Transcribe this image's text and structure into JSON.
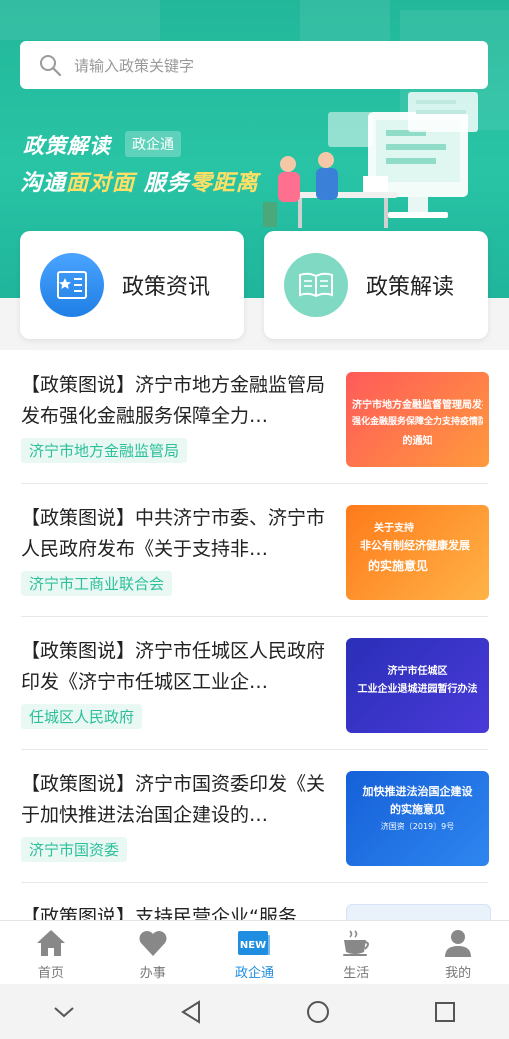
{
  "search": {
    "placeholder": "请输入政策关键字"
  },
  "banner": {
    "title": "政策解读",
    "tag": "政企通",
    "slogan_a": "沟通",
    "slogan_b": "面对面",
    "slogan_c": " 服务",
    "slogan_d": "零距离"
  },
  "cards": [
    {
      "label": "政策资讯",
      "icon": "news-book-icon",
      "color": "#2f8ff0"
    },
    {
      "label": "政策解读",
      "icon": "open-book-icon",
      "color": "#34c3a0"
    }
  ],
  "articles": [
    {
      "title": "【政策图说】济宁市地方金融监管局发布强化金融服务保障全力…",
      "tag": "济宁市地方金融监管局",
      "thumb_lines": [
        "济宁市地方金融监督管理局发布",
        "强化金融服务保障全力支持疫情防控工作",
        "的通知"
      ]
    },
    {
      "title": "【政策图说】中共济宁市委、济宁市人民政府发布《关于支持非…",
      "tag": "济宁市工商业联合会",
      "thumb_lines": [
        "关于支持",
        "非公有制经济健康发展",
        "的实施意见"
      ]
    },
    {
      "title": "【政策图说】济宁市任城区人民政府印发《济宁市任城区工业企…",
      "tag": "任城区人民政府",
      "thumb_lines": [
        "济宁市任城区",
        "工业企业退城进园暂行办法"
      ]
    },
    {
      "title": "【政策图说】济宁市国资委印发《关于加快推进法治国企建设的…",
      "tag": "济宁市国资委",
      "thumb_lines": [
        "加快推进法治国企建设",
        "的实施意见",
        "济国资〔2019〕9号"
      ]
    },
    {
      "title": "【政策图说】支持民营企业“服务…",
      "tag": "",
      "thumb_lines": []
    }
  ],
  "tabs": [
    {
      "label": "首页",
      "icon": "home-icon",
      "active": false
    },
    {
      "label": "办事",
      "icon": "heart-icon",
      "active": false
    },
    {
      "label": "政企通",
      "icon": "new-badge-icon",
      "active": true
    },
    {
      "label": "生活",
      "icon": "coffee-cup-icon",
      "active": false
    },
    {
      "label": "我的",
      "icon": "user-icon",
      "active": false
    }
  ],
  "colors": {
    "accent": "#29c4a5",
    "tab_active": "#1f8de0",
    "tag_text": "#2bbf9a"
  }
}
